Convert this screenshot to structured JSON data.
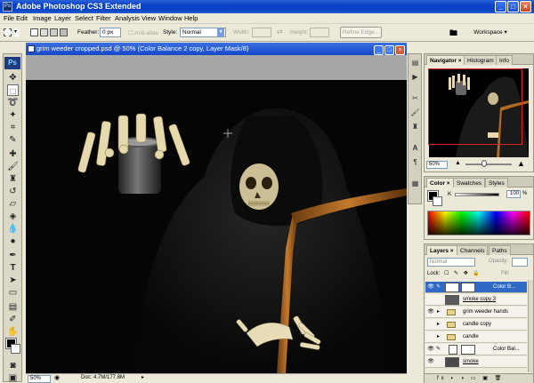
{
  "window": {
    "title": "Adobe Photoshop CS3 Extended",
    "app_badge": "Ps"
  },
  "menu": [
    "File",
    "Edit",
    "Image",
    "Layer",
    "Select",
    "Filter",
    "Analysis",
    "View",
    "Window",
    "Help"
  ],
  "options": {
    "feather_label": "Feather:",
    "feather_value": "0 px",
    "antialias_label": "Anti-alias",
    "style_label": "Style:",
    "style_value": "Normal",
    "width_label": "Width:",
    "height_label": "Height:",
    "refine_label": "Refine Edge...",
    "workspace_label": "Workspace ▾"
  },
  "document": {
    "title": "grim weeder cropped.psd @ 50% (Color Balance 2 copy, Layer Mask/8)",
    "zoom": "50%",
    "doc_info": "Doc: 4.7M/177.8M"
  },
  "navigator": {
    "tabs": [
      "Navigator ×",
      "Histogram",
      "Info"
    ],
    "zoom": "50%"
  },
  "color": {
    "tabs": [
      "Color ×",
      "Swatches",
      "Styles"
    ],
    "channel": "K",
    "value": "100",
    "unit": "%"
  },
  "layers": {
    "tabs": [
      "Layers ×",
      "Channels",
      "Paths"
    ],
    "blend_mode": "Normal",
    "opacity_label": "Opacity:",
    "lock_label": "Lock:",
    "fill_label": "Fill:",
    "items": [
      {
        "name": "Color B...",
        "type": "adjustment",
        "selected": true
      },
      {
        "name": "smoke copy 3",
        "type": "pixel",
        "selected": false
      },
      {
        "name": "grim weeder hands",
        "type": "group",
        "selected": false
      },
      {
        "name": "candle copy",
        "type": "group",
        "selected": false
      },
      {
        "name": "candle",
        "type": "group",
        "selected": false
      },
      {
        "name": "Color Bal...",
        "type": "adjustment",
        "selected": false
      },
      {
        "name": "smoke",
        "type": "pixel",
        "selected": false
      }
    ],
    "footer": "fx ◐ ◑ ▭ ▣ 🗑"
  }
}
